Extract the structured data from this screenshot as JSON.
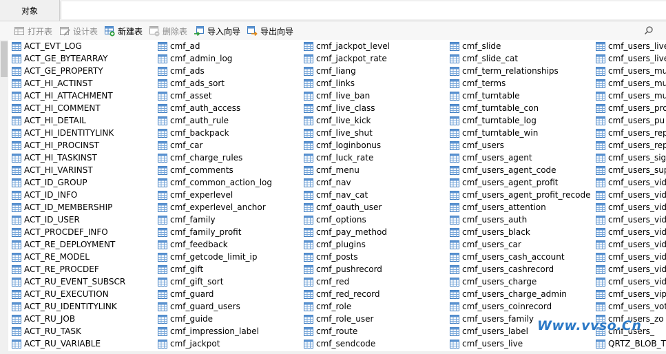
{
  "tabs": [
    {
      "label": "对象",
      "active": true
    }
  ],
  "toolbar": {
    "buttons": [
      {
        "label": "打开表",
        "icon": "open-table-icon",
        "enabled": false
      },
      {
        "label": "设计表",
        "icon": "design-table-icon",
        "enabled": false
      },
      {
        "label": "新建表",
        "icon": "new-table-icon",
        "enabled": true
      },
      {
        "label": "删除表",
        "icon": "delete-table-icon",
        "enabled": false
      },
      {
        "label": "导入向导",
        "icon": "import-wizard-icon",
        "enabled": true
      },
      {
        "label": "导出向导",
        "icon": "export-wizard-icon",
        "enabled": true
      }
    ],
    "search_icon": "search-icon"
  },
  "columns": [
    [
      "ACT_EVT_LOG",
      "ACT_GE_BYTEARRAY",
      "ACT_GE_PROPERTY",
      "ACT_HI_ACTINST",
      "ACT_HI_ATTACHMENT",
      "ACT_HI_COMMENT",
      "ACT_HI_DETAIL",
      "ACT_HI_IDENTITYLINK",
      "ACT_HI_PROCINST",
      "ACT_HI_TASKINST",
      "ACT_HI_VARINST",
      "ACT_ID_GROUP",
      "ACT_ID_INFO",
      "ACT_ID_MEMBERSHIP",
      "ACT_ID_USER",
      "ACT_PROCDEF_INFO",
      "ACT_RE_DEPLOYMENT",
      "ACT_RE_MODEL",
      "ACT_RE_PROCDEF",
      "ACT_RU_EVENT_SUBSCR",
      "ACT_RU_EXECUTION",
      "ACT_RU_IDENTITYLINK",
      "ACT_RU_JOB",
      "ACT_RU_TASK",
      "ACT_RU_VARIABLE"
    ],
    [
      "cmf_ad",
      "cmf_admin_log",
      "cmf_ads",
      "cmf_ads_sort",
      "cmf_asset",
      "cmf_auth_access",
      "cmf_auth_rule",
      "cmf_backpack",
      "cmf_car",
      "cmf_charge_rules",
      "cmf_comments",
      "cmf_common_action_log",
      "cmf_experlevel",
      "cmf_experlevel_anchor",
      "cmf_family",
      "cmf_family_profit",
      "cmf_feedback",
      "cmf_getcode_limit_ip",
      "cmf_gift",
      "cmf_gift_sort",
      "cmf_guard",
      "cmf_guard_users",
      "cmf_guide",
      "cmf_impression_label",
      "cmf_jackpot"
    ],
    [
      "cmf_jackpot_level",
      "cmf_jackpot_rate",
      "cmf_liang",
      "cmf_links",
      "cmf_live_ban",
      "cmf_live_class",
      "cmf_live_kick",
      "cmf_live_shut",
      "cmf_loginbonus",
      "cmf_luck_rate",
      "cmf_menu",
      "cmf_nav",
      "cmf_nav_cat",
      "cmf_oauth_user",
      "cmf_options",
      "cmf_pay_method",
      "cmf_plugins",
      "cmf_posts",
      "cmf_pushrecord",
      "cmf_red",
      "cmf_red_record",
      "cmf_role",
      "cmf_role_user",
      "cmf_route",
      "cmf_sendcode"
    ],
    [
      "cmf_slide",
      "cmf_slide_cat",
      "cmf_term_relationships",
      "cmf_terms",
      "cmf_turntable",
      "cmf_turntable_con",
      "cmf_turntable_log",
      "cmf_turntable_win",
      "cmf_users",
      "cmf_users_agent",
      "cmf_users_agent_code",
      "cmf_users_agent_profit",
      "cmf_users_agent_profit_recode",
      "cmf_users_attention",
      "cmf_users_auth",
      "cmf_users_black",
      "cmf_users_car",
      "cmf_users_cash_account",
      "cmf_users_cashrecord",
      "cmf_users_charge",
      "cmf_users_charge_admin",
      "cmf_users_coinrecord",
      "cmf_users_family",
      "cmf_users_label",
      "cmf_users_live"
    ],
    [
      "cmf_users_live",
      "cmf_users_live",
      "cmf_users_mu",
      "cmf_users_mu",
      "cmf_users_mu",
      "cmf_users_pro",
      "cmf_users_pu",
      "cmf_users_rep",
      "cmf_users_rep",
      "cmf_users_sig",
      "cmf_users_sup",
      "cmf_users_vid",
      "cmf_users_vid",
      "cmf_users_vid",
      "cmf_users_vid",
      "cmf_users_vid",
      "cmf_users_vid",
      "cmf_users_vid",
      "cmf_users_vid",
      "cmf_users_vid",
      "cmf_users_vip",
      "cmf_users_vot",
      "cmf_users_zo",
      "cmf_users_",
      "QRTZ_BLOB_T"
    ]
  ],
  "watermark": "Www.vvso.Cn",
  "colors": {
    "tab_bg": "#f0f0f0",
    "toolbar_bg": "#f7f7f7",
    "table_icon_border": "#3a7ac0",
    "table_icon_header": "#5b93d1",
    "watermark": "#2a78c6"
  }
}
